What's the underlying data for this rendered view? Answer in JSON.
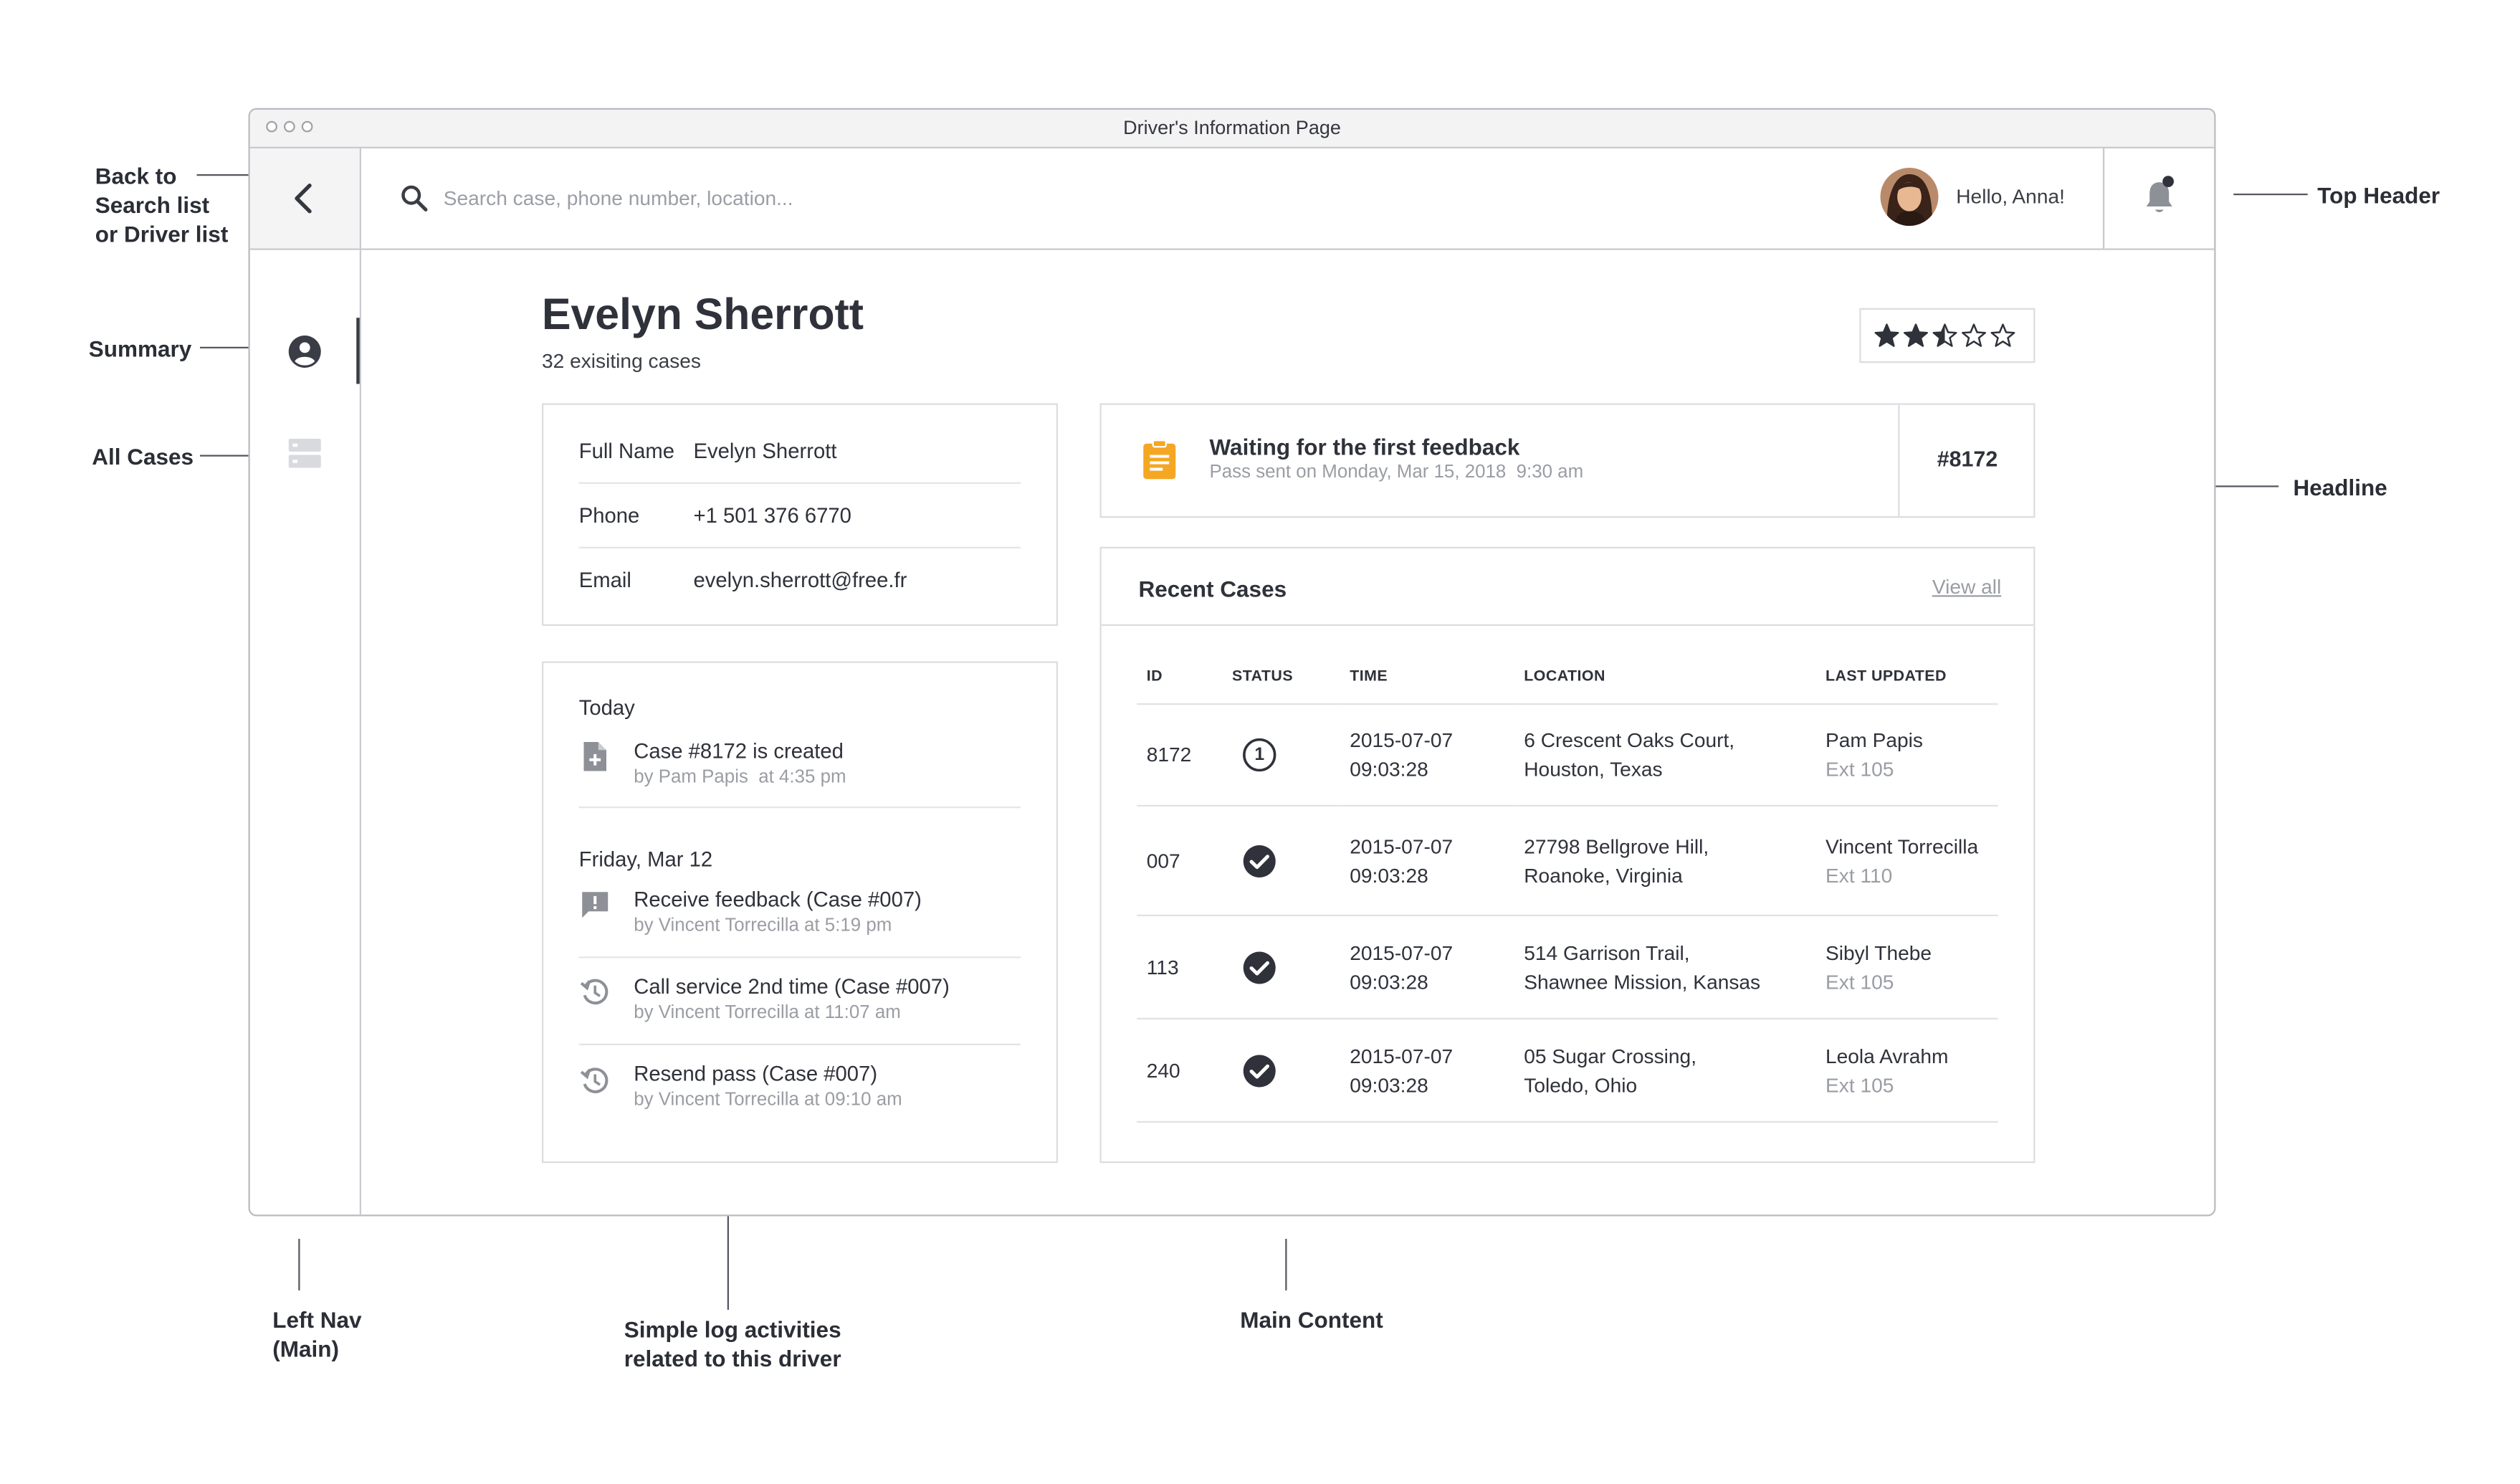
{
  "annotations": {
    "back": [
      "Back to",
      "Search list",
      "or Driver list"
    ],
    "summary": "Summary",
    "all_cases": "All Cases",
    "top_header": "Top Header",
    "headline": "Headline",
    "left_nav": [
      "Left Nav",
      "(Main)"
    ],
    "log": [
      "Simple log activities",
      "related to this driver"
    ],
    "main_content": "Main Content"
  },
  "window": {
    "title": "Driver's Information Page"
  },
  "header": {
    "search_placeholder": "Search case, phone number, location...",
    "greeting": "Hello, Anna!"
  },
  "nav": {
    "items": [
      {
        "icon": "account-circle-icon",
        "active": true
      },
      {
        "icon": "storage-list-icon",
        "active": false
      }
    ]
  },
  "driver": {
    "name": "Evelyn Sherrott",
    "cases_summary": "32 exisiting cases",
    "rating": 2.5,
    "rating_max": 5
  },
  "details": [
    {
      "label": "Full Name",
      "value": "Evelyn Sherrott"
    },
    {
      "label": "Phone",
      "value": "+1 501 376 6770"
    },
    {
      "label": "Email",
      "value": "evelyn.sherrott@free.fr"
    }
  ],
  "activity_log": {
    "groups": [
      {
        "date": "Today",
        "items": [
          {
            "icon": "file-add-icon",
            "title": "Case #8172 is created",
            "meta": "by Pam Papis  at 4:35 pm"
          }
        ]
      },
      {
        "date": "Friday, Mar 12",
        "items": [
          {
            "icon": "feedback-icon",
            "title": "Receive feedback (Case #007)",
            "meta": "by Vincent Torrecilla at 5:19 pm"
          },
          {
            "icon": "history-icon",
            "title": "Call service 2nd time (Case #007)",
            "meta": "by Vincent Torrecilla at 11:07 am"
          },
          {
            "icon": "history-icon",
            "title": "Resend pass (Case #007)",
            "meta": "by Vincent Torrecilla at 09:10 am"
          }
        ]
      }
    ]
  },
  "headline": {
    "icon": "clipboard-icon",
    "accent_color": "#f5a623",
    "title": "Waiting for the first feedback",
    "subtitle": "Pass sent on Monday, Mar 15, 2018  9:30 am",
    "case_id": "#8172"
  },
  "recent_cases": {
    "title": "Recent Cases",
    "view_all": "View all",
    "columns": [
      "ID",
      "STATUS",
      "TIME",
      "LOCATION",
      "LAST UPDATED"
    ],
    "rows": [
      {
        "id": "8172",
        "status": "pending-1",
        "status_label": "1",
        "date": "2015-07-07",
        "time": "09:03:28",
        "loc1": "6 Crescent Oaks Court,",
        "loc2": "Houston, Texas",
        "person": "Pam Papis",
        "ext": "Ext 105"
      },
      {
        "id": "007",
        "status": "done",
        "status_label": "",
        "date": "2015-07-07",
        "time": "09:03:28",
        "loc1": "27798 Bellgrove Hill,",
        "loc2": "Roanoke, Virginia",
        "person": "Vincent Torrecilla",
        "ext": "Ext 110"
      },
      {
        "id": "113",
        "status": "done",
        "status_label": "",
        "date": "2015-07-07",
        "time": "09:03:28",
        "loc1": "514 Garrison Trail,",
        "loc2": "Shawnee Mission, Kansas",
        "person": "Sibyl Thebe",
        "ext": "Ext 105"
      },
      {
        "id": "240",
        "status": "done",
        "status_label": "",
        "date": "2015-07-07",
        "time": "09:03:28",
        "loc1": "05 Sugar Crossing,",
        "loc2": "Toledo, Ohio",
        "person": "Leola Avrahm",
        "ext": "Ext 105"
      }
    ]
  }
}
